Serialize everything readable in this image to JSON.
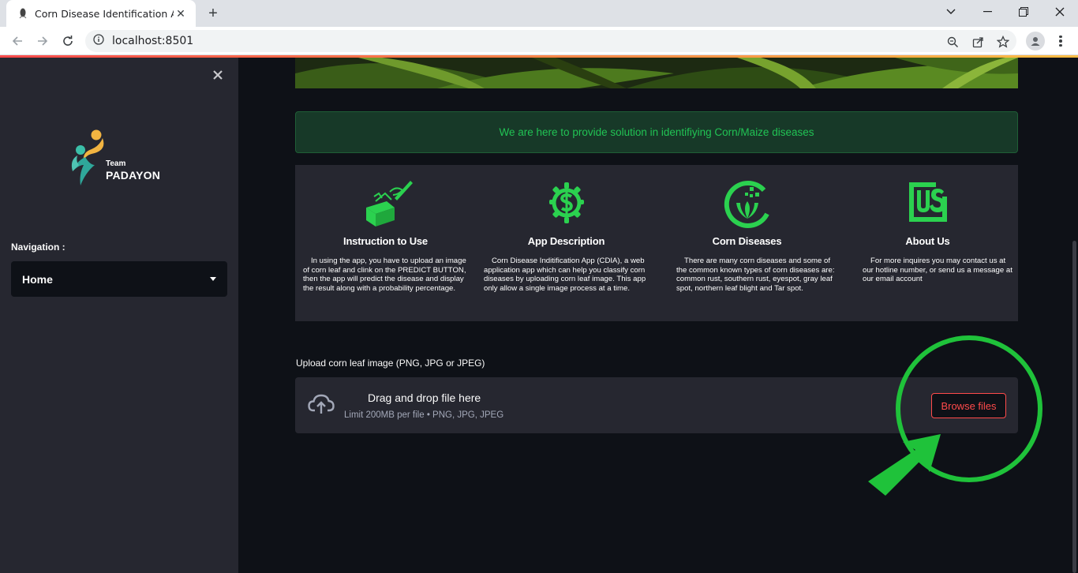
{
  "browser": {
    "tab_title": "Corn Disease Identification App",
    "url": "localhost:8501"
  },
  "sidebar": {
    "logo_team": "Team",
    "logo_name": "PADAYON",
    "nav_label": "Navigation :",
    "nav_selected": "Home"
  },
  "main": {
    "info_message": "We are here to provide solution in identifiying Corn/Maize diseases",
    "features": [
      {
        "title": "Instruction to Use",
        "icon": "box-pencil-icon",
        "description": "In using the app, you have to upload an image of corn leaf and clink on the PREDICT BUTTON, then the app will predict the disease and display the result along with a probability percentage."
      },
      {
        "title": "App Description",
        "icon": "gear-dollar-icon",
        "description": "Corn Disease Inditification App (CDIA), a web application app which can help you classify corn diseases by uploading corn leaf image. This app only allow a single image process at a time."
      },
      {
        "title": "Corn Diseases",
        "icon": "leaf-circle-icon",
        "description": "There are many corn diseases and some of the common known types of corn diseases are: common rust, southern rust, eyespot, gray leaf spot, northern leaf blight and Tar spot."
      },
      {
        "title": "About Us",
        "icon": "us-badge-icon",
        "description": "For more inquires you may contact us at our hotline number, or send us a message at our email account"
      }
    ],
    "uploader": {
      "label": "Upload corn leaf image (PNG, JPG or JPEG)",
      "drop_title": "Drag and drop file here",
      "drop_sub": "Limit 200MB per file • PNG, JPG, JPEG",
      "browse_label": "Browse files"
    }
  },
  "colors": {
    "accent": "#ff4b4b",
    "success_text": "#21c354",
    "highlight": "#1fc23a"
  }
}
